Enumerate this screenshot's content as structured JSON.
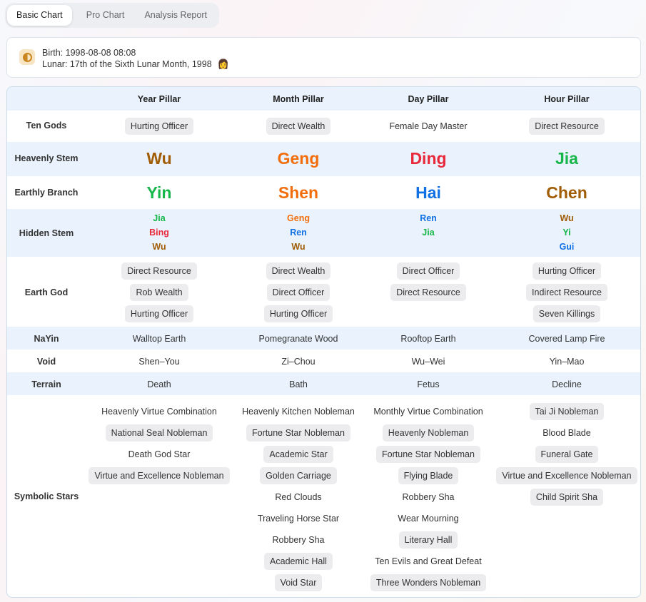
{
  "tabs": [
    "Basic Chart",
    "Pro Chart",
    "Analysis Report"
  ],
  "info": {
    "birth": "Birth: 1998-08-08 08:08",
    "lunar": "Lunar: 17th of the Sixth Lunar Month, 1998",
    "gender_icon": "👩"
  },
  "colors": {
    "earth": "#a15c06",
    "metal": "#f26d0c",
    "fire": "#e8293c",
    "wood": "#16b64a",
    "water": "#1170e3",
    "header_row_bg": "#eaf3fd"
  },
  "headers": [
    "Year Pillar",
    "Month Pillar",
    "Day Pillar",
    "Hour Pillar"
  ],
  "labels": {
    "ten_gods": "Ten Gods",
    "heavenly_stem": "Heavenly Stem",
    "earthly_branch": "Earthly Branch",
    "hidden_stem": "Hidden Stem",
    "earth_god": "Earth God",
    "nayin": "NaYin",
    "void": "Void",
    "terrain": "Terrain",
    "symbolic_stars": "Symbolic Stars"
  },
  "ten_gods": [
    "Hurting Officer",
    "Direct Wealth",
    "Female Day Master",
    "Direct Resource"
  ],
  "stems": [
    {
      "text": "Wu",
      "color": "#a15c06"
    },
    {
      "text": "Geng",
      "color": "#f26d0c"
    },
    {
      "text": "Ding",
      "color": "#e8293c"
    },
    {
      "text": "Jia",
      "color": "#16b64a"
    }
  ],
  "branches": [
    {
      "text": "Yin",
      "color": "#16b64a"
    },
    {
      "text": "Shen",
      "color": "#f26d0c"
    },
    {
      "text": "Hai",
      "color": "#1170e3"
    },
    {
      "text": "Chen",
      "color": "#a15c06"
    }
  ],
  "hidden": [
    [
      {
        "text": "Jia",
        "color": "#16b64a"
      },
      {
        "text": "Bing",
        "color": "#e8293c"
      },
      {
        "text": "Wu",
        "color": "#a15c06"
      }
    ],
    [
      {
        "text": "Geng",
        "color": "#f26d0c"
      },
      {
        "text": "Ren",
        "color": "#1170e3"
      },
      {
        "text": "Wu",
        "color": "#a15c06"
      }
    ],
    [
      {
        "text": "Ren",
        "color": "#1170e3"
      },
      {
        "text": "Jia",
        "color": "#16b64a"
      }
    ],
    [
      {
        "text": "Wu",
        "color": "#a15c06"
      },
      {
        "text": "Yi",
        "color": "#16b64a"
      },
      {
        "text": "Gui",
        "color": "#1170e3"
      }
    ]
  ],
  "earth_god": [
    [
      "Direct Resource",
      "Rob Wealth",
      "Hurting Officer"
    ],
    [
      "Direct Wealth",
      "Direct Officer",
      "Hurting Officer"
    ],
    [
      "Direct Officer",
      "Direct Resource"
    ],
    [
      "Hurting Officer",
      "Indirect Resource",
      "Seven Killings"
    ]
  ],
  "nayin": [
    "Walltop Earth",
    "Pomegranate Wood",
    "Rooftop Earth",
    "Covered Lamp Fire"
  ],
  "void": [
    "Shen–You",
    "Zi–Chou",
    "Wu–Wei",
    "Yin–Mao"
  ],
  "terrain": [
    "Death",
    "Bath",
    "Fetus",
    "Decline"
  ],
  "stars": [
    [
      {
        "text": "Heavenly Virtue Combination",
        "chip": false
      },
      {
        "text": "National Seal Nobleman",
        "chip": true
      },
      {
        "text": "Death God Star",
        "chip": false
      },
      {
        "text": "Virtue and Excellence Nobleman",
        "chip": true
      }
    ],
    [
      {
        "text": "Heavenly Kitchen Nobleman",
        "chip": false
      },
      {
        "text": "Fortune Star Nobleman",
        "chip": true
      },
      {
        "text": "Academic Star",
        "chip": true
      },
      {
        "text": "Golden Carriage",
        "chip": true
      },
      {
        "text": "Red Clouds",
        "chip": false
      },
      {
        "text": "Traveling Horse Star",
        "chip": false
      },
      {
        "text": "Robbery Sha",
        "chip": false
      },
      {
        "text": "Academic Hall",
        "chip": true
      },
      {
        "text": "Void Star",
        "chip": true
      }
    ],
    [
      {
        "text": "Monthly Virtue Combination",
        "chip": false
      },
      {
        "text": "Heavenly Nobleman",
        "chip": true
      },
      {
        "text": "Fortune Star Nobleman",
        "chip": true
      },
      {
        "text": "Flying Blade",
        "chip": true
      },
      {
        "text": "Robbery Sha",
        "chip": false
      },
      {
        "text": "Wear Mourning",
        "chip": false
      },
      {
        "text": "Literary Hall",
        "chip": true
      },
      {
        "text": "Ten Evils and Great Defeat",
        "chip": false
      },
      {
        "text": "Three Wonders Nobleman",
        "chip": true
      }
    ],
    [
      {
        "text": "Tai Ji Nobleman",
        "chip": true
      },
      {
        "text": "Blood Blade",
        "chip": false
      },
      {
        "text": "Funeral Gate",
        "chip": true
      },
      {
        "text": "Virtue and Excellence Nobleman",
        "chip": true
      },
      {
        "text": "Child Spirit Sha",
        "chip": true
      }
    ]
  ]
}
